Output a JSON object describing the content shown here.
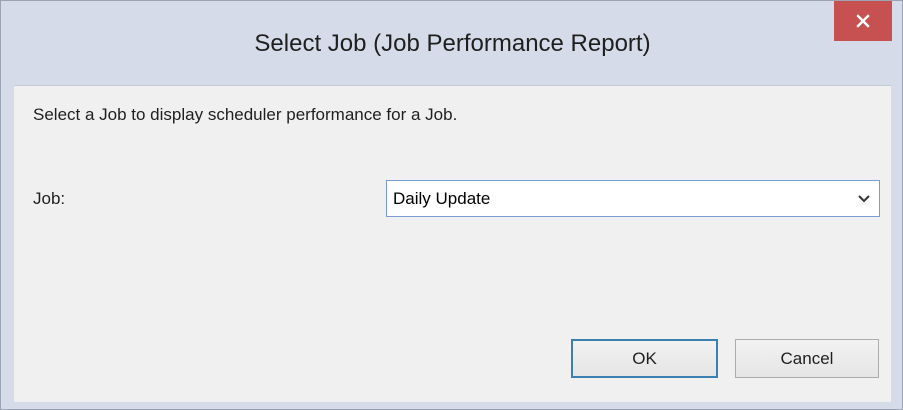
{
  "window": {
    "title": "Select Job (Job Performance Report)",
    "close_icon": "close-icon"
  },
  "form": {
    "description": "Select a Job to display scheduler performance for a Job.",
    "job_label": "Job:",
    "job_value": "Daily Update",
    "dropdown_icon": "chevron-down-icon"
  },
  "buttons": {
    "ok": "OK",
    "cancel": "Cancel"
  },
  "colors": {
    "frame": "#d6dbe9",
    "close_button": "#c75050",
    "client": "#f0f0f0",
    "default_button_border": "#3c7fb1"
  }
}
